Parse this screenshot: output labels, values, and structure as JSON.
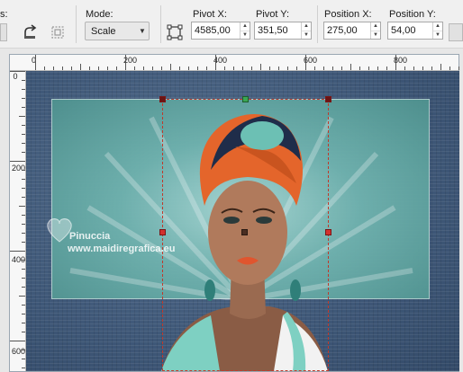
{
  "toolbar": {
    "mode_label": "Mode:",
    "mode_value": "Scale",
    "pivot_x_label": "Pivot X:",
    "pivot_x_value": "4585,00",
    "pivot_y_label": "Pivot Y:",
    "pivot_y_value": "351,50",
    "position_x_label": "Position X:",
    "position_x_value": "275,00",
    "position_y_label": "Position Y:",
    "position_y_value": "54,00",
    "left_edge_label": "s:"
  },
  "ruler": {
    "h_labels": [
      "0",
      "200",
      "400",
      "600",
      "800"
    ],
    "v_labels": [
      "0",
      "200",
      "400",
      "600"
    ]
  },
  "watermark": {
    "name": "Pinuccia",
    "site": "www.maidiregrafica.eu"
  },
  "colors": {
    "canvas_bg": "#3d5677",
    "inner_rect": "#7bbab6",
    "selection": "#c0392b",
    "turban_orange": "#e4652b",
    "turban_navy": "#1f2d4a",
    "turban_teal": "#6cc0b4"
  }
}
